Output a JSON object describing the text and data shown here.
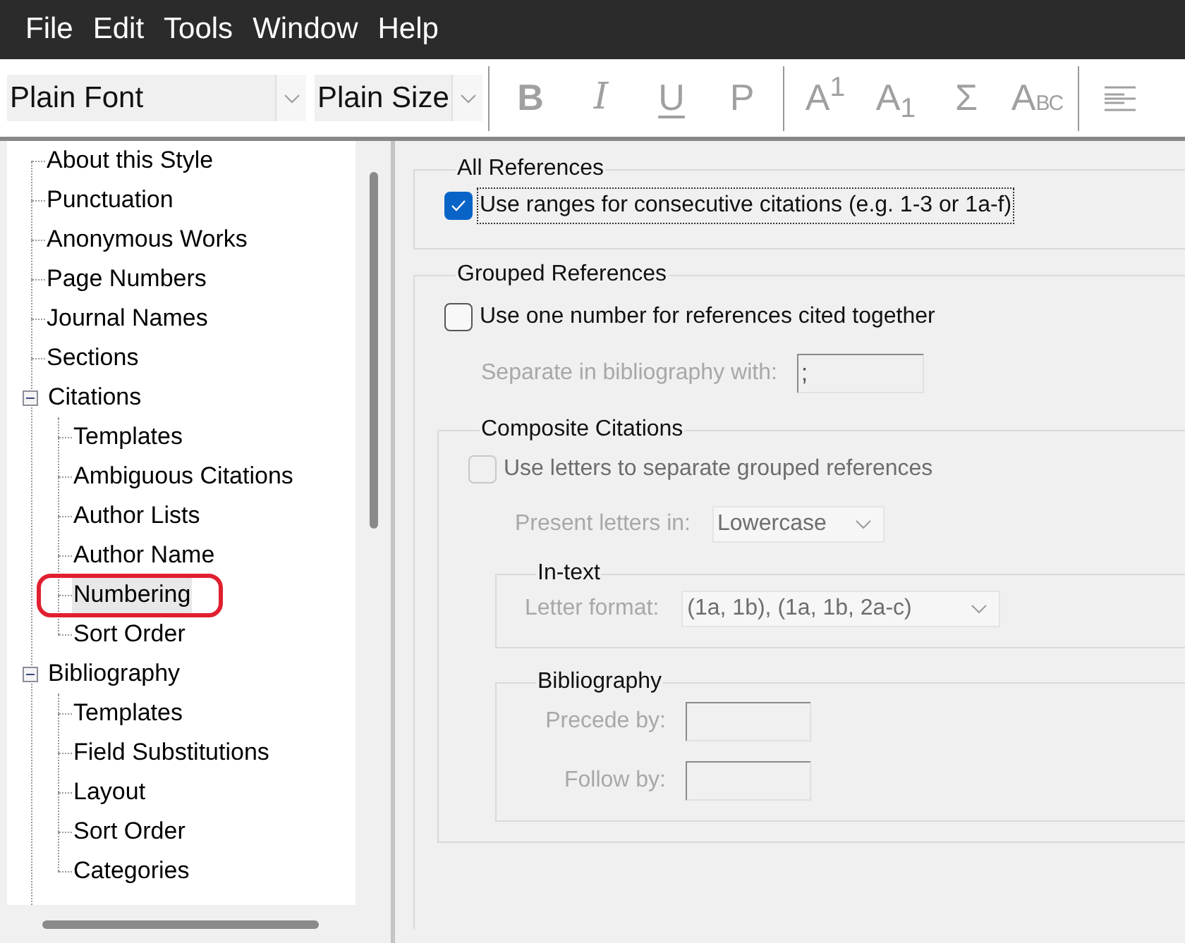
{
  "menu_bar": [
    {
      "label": "File"
    },
    {
      "label": "Edit"
    },
    {
      "label": "Tools"
    },
    {
      "label": "Window"
    },
    {
      "label": "Help"
    }
  ],
  "toolbar": {
    "font_select": {
      "value": "Plain Font"
    },
    "size_select": {
      "value": "Plain Size"
    },
    "groups": [
      [
        {
          "kind": "bold",
          "label": "B",
          "disabled": true
        },
        {
          "kind": "italic",
          "label": "I",
          "disabled": true
        },
        {
          "kind": "underline",
          "label": "U",
          "disabled": true
        },
        {
          "kind": "plain",
          "label": "P",
          "disabled": true
        }
      ],
      [
        {
          "kind": "superscript",
          "label": "A$^{1}$",
          "disabled": true
        },
        {
          "kind": "subscript",
          "label": "A$_{1}$",
          "disabled": true
        },
        {
          "kind": "symbol",
          "label": "Σ",
          "disabled": true
        },
        {
          "kind": "smallcaps",
          "label": "ABC",
          "disabled": true
        }
      ],
      [
        {
          "kind": "align",
          "disabled": true
        }
      ]
    ]
  },
  "style_tree": [
    {
      "label": "About this Style",
      "selected": false
    },
    {
      "label": "Punctuation",
      "selected": false
    },
    {
      "label": "Anonymous Works",
      "selected": false
    },
    {
      "label": "Page Numbers",
      "selected": false
    },
    {
      "label": "Journal Names",
      "selected": false
    },
    {
      "label": "Sections",
      "selected": false
    },
    {
      "label": "Citations",
      "selected": false,
      "expanded": true,
      "children": [
        {
          "label": "Templates",
          "selected": false,
          "circled": false
        },
        {
          "label": "Ambiguous Citations",
          "selected": false,
          "circled": false
        },
        {
          "label": "Author Lists",
          "selected": false,
          "circled": false
        },
        {
          "label": "Author Name",
          "selected": false,
          "circled": false
        },
        {
          "label": "Numbering",
          "selected": true,
          "circled": true
        },
        {
          "label": "Sort Order",
          "selected": false,
          "circled": false
        }
      ]
    },
    {
      "label": "Bibliography",
      "selected": false,
      "expanded": true,
      "children": [
        {
          "label": "Templates",
          "selected": false,
          "circled": false
        },
        {
          "label": "Field Substitutions",
          "selected": false,
          "circled": false
        },
        {
          "label": "Layout",
          "selected": false,
          "circled": false
        },
        {
          "label": "Sort Order",
          "selected": false,
          "circled": false
        },
        {
          "label": "Categories",
          "selected": false,
          "circled": false
        }
      ]
    }
  ],
  "all_references": {
    "title": "All References",
    "checkbox": {
      "label": "Use ranges for consecutive citations (e.g. 1-3 or 1a-f)",
      "checked": true,
      "disabled": false,
      "focused": true
    }
  },
  "grouped_references": {
    "title": "Grouped References",
    "checkbox": {
      "label": "Use one number for references cited together",
      "checked": false,
      "disabled": false,
      "focused": false
    },
    "separator_field": {
      "label": "Separate in bibliography with:",
      "value": ";",
      "disabled": true
    },
    "composite_citations": {
      "title": "Composite Citations",
      "checkbox": {
        "label": "Use letters to separate grouped references",
        "checked": false,
        "disabled": true,
        "focused": false
      },
      "present_letters": {
        "label": "Present letters in:",
        "value": "Lowercase",
        "disabled": true
      },
      "in_text": {
        "title": "In-text",
        "letter_format": {
          "label": "Letter format:",
          "value": "(1a, 1b), (1a, 1b, 2a-c)",
          "disabled": true
        }
      },
      "bibliography": {
        "title": "Bibliography",
        "precede_by": {
          "label": "Precede by:",
          "disabled": true
        },
        "follow_by": {
          "label": "Follow by:",
          "disabled": true
        }
      }
    }
  }
}
